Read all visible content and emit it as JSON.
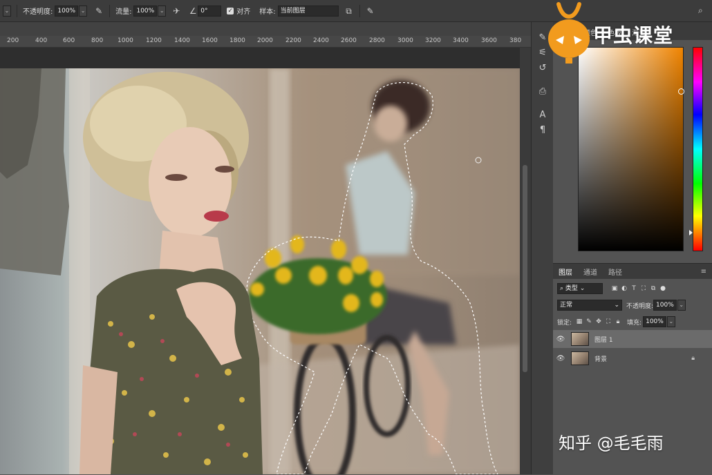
{
  "options_bar": {
    "opacity_label": "不透明度:",
    "opacity_value": "100%",
    "flow_label": "流量:",
    "flow_value": "100%",
    "angle_value": "0°",
    "align_label": "对齐",
    "sample_label": "样本:",
    "sample_value": "当前图层"
  },
  "ruler": {
    "ticks": [
      "200",
      "400",
      "600",
      "800",
      "1000",
      "1200",
      "1400",
      "1600",
      "1800",
      "2000",
      "2200",
      "2400",
      "2600",
      "2800",
      "3000",
      "3200",
      "3400",
      "3600",
      "380"
    ]
  },
  "color_panel": {
    "selected_color": "#f08400",
    "tabs": [
      "颜色",
      "色板",
      "渐变"
    ]
  },
  "layers_panel": {
    "tabs": [
      "图层",
      "通道",
      "路径"
    ],
    "filter_label": "类型",
    "blend_mode": "正常",
    "opacity_label": "不透明度:",
    "opacity_value": "100%",
    "lock_label": "锁定:",
    "fill_label": "填充:",
    "fill_value": "100%",
    "layers": [
      {
        "name": "图层 1",
        "selected": true
      },
      {
        "name": "背景",
        "locked": true
      }
    ]
  },
  "branding": {
    "logo_text": "甲虫课堂",
    "watermark": "知乎 @毛毛雨"
  },
  "colors": {
    "ui_dark": "#3c3c3c",
    "ui_mid": "#535353",
    "layer_selected": "#6b6b6b"
  }
}
